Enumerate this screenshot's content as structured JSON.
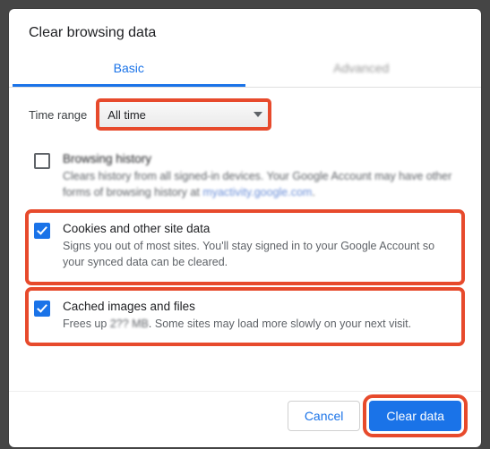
{
  "dialog": {
    "title": "Clear browsing data",
    "tabs": {
      "basic": "Basic",
      "advanced": "Advanced"
    },
    "time_range_label": "Time range",
    "time_range_value": "All time"
  },
  "options": {
    "history": {
      "title": "Browsing history",
      "desc_a": "Clears history from all signed-in devices. Your Google Account may have other forms of browsing history at ",
      "desc_link": "myactivity.google.com",
      "desc_b": "."
    },
    "cookies": {
      "title": "Cookies and other site data",
      "desc": "Signs you out of most sites. You'll stay signed in to your Google Account so your synced data can be cleared."
    },
    "cache": {
      "title": "Cached images and files",
      "desc_a": "Frees up ",
      "desc_size": "2?? MB",
      "desc_b": ". Some sites may load more slowly on your next visit."
    }
  },
  "footer": {
    "cancel": "Cancel",
    "clear": "Clear data"
  }
}
